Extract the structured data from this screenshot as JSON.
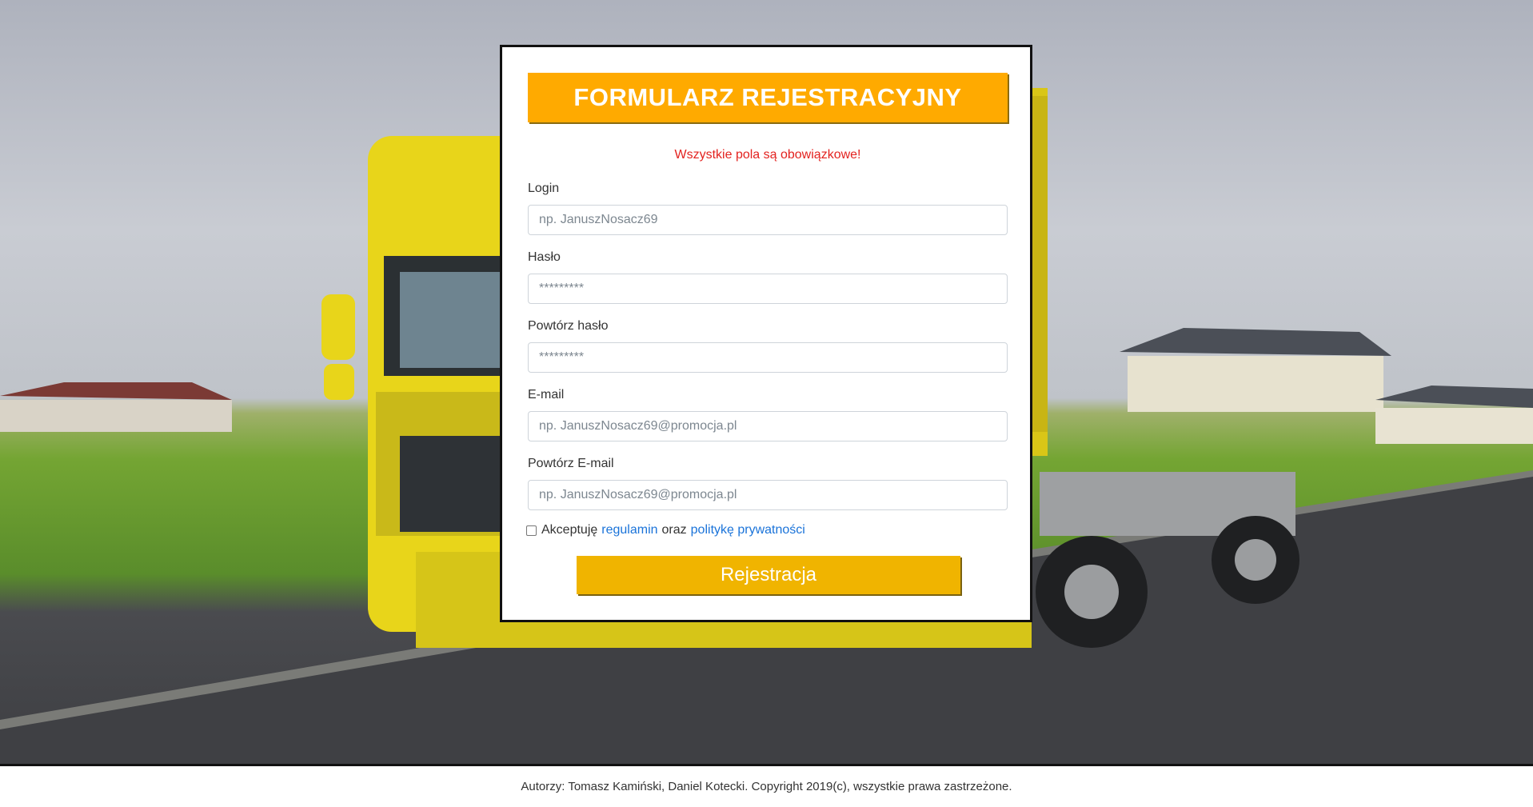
{
  "form": {
    "title": "FORMULARZ REJESTRACYJNY",
    "required_note": "Wszystkie pola są obowiązkowe!",
    "fields": [
      {
        "label": "Login",
        "placeholder": "np. JanuszNosacz69"
      },
      {
        "label": "Hasło",
        "placeholder": "*********"
      },
      {
        "label": "Powtórz hasło",
        "placeholder": "*********"
      },
      {
        "label": "E-mail",
        "placeholder": "np. JanuszNosacz69@promocja.pl"
      },
      {
        "label": "Powtórz E-mail",
        "placeholder": "np. JanuszNosacz69@promocja.pl"
      }
    ],
    "terms": {
      "prefix": "Akceptuję",
      "link1": "regulamin",
      "middle": "oraz",
      "link2": "politykę prywatności",
      "checked": false
    },
    "submit_label": "Rejestracja"
  },
  "footer": {
    "text": "Autorzy: Tomasz Kamiński, Daniel Kotecki. Copyright 2019(c), wszystkie prawa zastrzeżone."
  },
  "colors": {
    "title_bg": "#ffaa00",
    "button_bg": "#f0b400",
    "required_text": "#e3221f",
    "link": "#1a73d9"
  }
}
